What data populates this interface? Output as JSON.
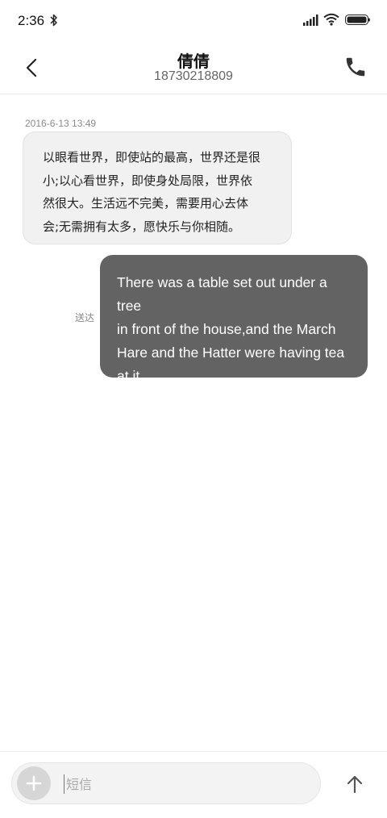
{
  "status_bar": {
    "time": "2:36",
    "icons": [
      "bluetooth-icon",
      "signal-icon",
      "wifi-icon",
      "battery-icon"
    ]
  },
  "header": {
    "contact_name": "倩倩",
    "contact_number": "18730218809",
    "icons": [
      "chevron-left-icon",
      "phone-icon"
    ]
  },
  "conversation": {
    "timestamp": "2016-6-13 13:49",
    "incoming_message": {
      "lines": [
        "以眼看世界，即使站的最高，世界还是很",
        "小;以心看世界，即使身处局限，世界依",
        "然很大。生活远不完美，需要用心去体",
        "会;无需拥有太多，愿快乐与你相随。"
      ]
    },
    "outgoing_message": {
      "status": "送达",
      "lines": [
        "There was a table set out under a tree",
        "in front of the house,and the March",
        "Hare and the Hatter were having tea",
        "at it."
      ]
    }
  },
  "composer": {
    "placeholder": "短信",
    "value": "",
    "icons": [
      "plus-icon",
      "arrow-up-icon"
    ]
  },
  "colors": {
    "incoming_bubble": "#f1f1f1",
    "outgoing_bubble": "#636363",
    "cursor": "#3b7ee0"
  }
}
